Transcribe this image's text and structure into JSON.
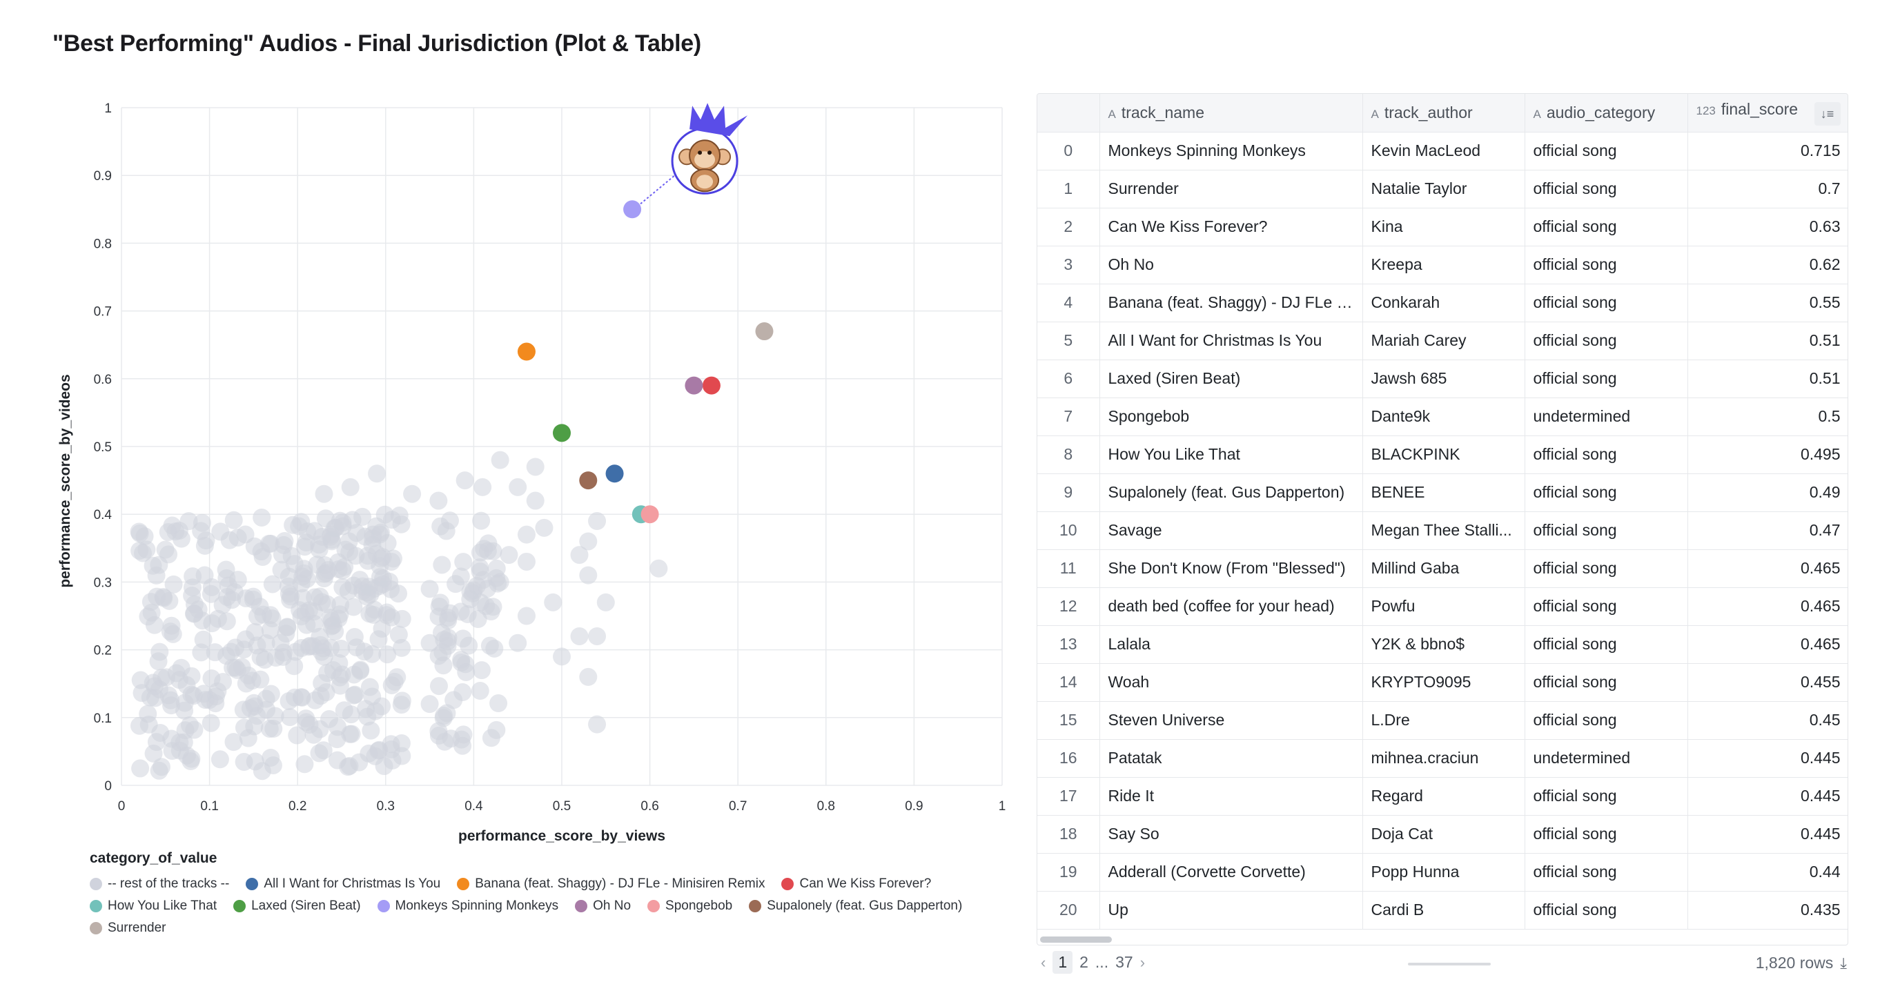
{
  "page": {
    "title": "\"Best Performing\" Audios - Final Jurisdiction (Plot & Table)"
  },
  "chart_data": {
    "type": "scatter",
    "xlabel": "performance_score_by_views",
    "ylabel": "performance_score_by_videos",
    "xlim": [
      0,
      1
    ],
    "ylim": [
      0,
      1
    ],
    "x_ticks": [
      "0",
      "0.1",
      "0.2",
      "0.3",
      "0.4",
      "0.5",
      "0.6",
      "0.7",
      "0.8",
      "0.9",
      "1"
    ],
    "y_ticks": [
      "0",
      "0.1",
      "0.2",
      "0.3",
      "0.4",
      "0.5",
      "0.6",
      "0.7",
      "0.8",
      "0.9",
      "1"
    ],
    "grid": true,
    "legend_title": "category_of_value",
    "legend_position": "bottom-left",
    "annotation": "crowned-monkey-icon pointing to Monkeys Spinning Monkeys",
    "series": [
      {
        "name": "-- rest of the tracks --",
        "color": "#d0d3dd",
        "background": true,
        "clusters": [
          {
            "x": [
              0.02,
              0.32
            ],
            "y": [
              0.02,
              0.4
            ],
            "n": 380
          },
          {
            "x": [
              0.36,
              0.43
            ],
            "y": [
              0.05,
              0.4
            ],
            "n": 70
          }
        ],
        "points": [
          {
            "x": 0.43,
            "y": 0.48
          },
          {
            "x": 0.47,
            "y": 0.47
          },
          {
            "x": 0.45,
            "y": 0.44
          },
          {
            "x": 0.41,
            "y": 0.44
          },
          {
            "x": 0.39,
            "y": 0.45
          },
          {
            "x": 0.36,
            "y": 0.42
          },
          {
            "x": 0.47,
            "y": 0.42
          },
          {
            "x": 0.48,
            "y": 0.38
          },
          {
            "x": 0.46,
            "y": 0.37
          },
          {
            "x": 0.54,
            "y": 0.39
          },
          {
            "x": 0.53,
            "y": 0.36
          },
          {
            "x": 0.52,
            "y": 0.34
          },
          {
            "x": 0.46,
            "y": 0.33
          },
          {
            "x": 0.53,
            "y": 0.31
          },
          {
            "x": 0.61,
            "y": 0.32
          },
          {
            "x": 0.55,
            "y": 0.27
          },
          {
            "x": 0.49,
            "y": 0.27
          },
          {
            "x": 0.46,
            "y": 0.25
          },
          {
            "x": 0.52,
            "y": 0.22
          },
          {
            "x": 0.5,
            "y": 0.19
          },
          {
            "x": 0.54,
            "y": 0.22
          },
          {
            "x": 0.53,
            "y": 0.16
          },
          {
            "x": 0.54,
            "y": 0.09
          },
          {
            "x": 0.33,
            "y": 0.43
          },
          {
            "x": 0.29,
            "y": 0.46
          },
          {
            "x": 0.26,
            "y": 0.44
          },
          {
            "x": 0.23,
            "y": 0.43
          },
          {
            "x": 0.35,
            "y": 0.29
          },
          {
            "x": 0.35,
            "y": 0.21
          },
          {
            "x": 0.35,
            "y": 0.12
          },
          {
            "x": 0.45,
            "y": 0.21
          },
          {
            "x": 0.43,
            "y": 0.3
          },
          {
            "x": 0.44,
            "y": 0.34
          },
          {
            "x": 0.36,
            "y": 0.08
          },
          {
            "x": 0.42,
            "y": 0.07
          }
        ]
      },
      {
        "name": "All I Want for Christmas Is You",
        "color": "#3f6ea8",
        "points": [
          {
            "x": 0.56,
            "y": 0.46
          }
        ]
      },
      {
        "name": "Banana (feat. Shaggy) - DJ FLe - Minisiren Remix",
        "color": "#f28a1e",
        "points": [
          {
            "x": 0.46,
            "y": 0.64
          }
        ]
      },
      {
        "name": "Can We Kiss Forever?",
        "color": "#e1494f",
        "points": [
          {
            "x": 0.67,
            "y": 0.59
          }
        ]
      },
      {
        "name": "How You Like That",
        "color": "#72c1ba",
        "points": [
          {
            "x": 0.59,
            "y": 0.4
          }
        ]
      },
      {
        "name": "Laxed (Siren Beat)",
        "color": "#4e9e45",
        "points": [
          {
            "x": 0.5,
            "y": 0.52
          }
        ]
      },
      {
        "name": "Monkeys Spinning Monkeys",
        "color": "#a49cf6",
        "points": [
          {
            "x": 0.58,
            "y": 0.85
          }
        ]
      },
      {
        "name": "Oh No",
        "color": "#a87aa6",
        "points": [
          {
            "x": 0.65,
            "y": 0.59
          }
        ]
      },
      {
        "name": "Spongebob",
        "color": "#f39da1",
        "points": [
          {
            "x": 0.6,
            "y": 0.4
          }
        ]
      },
      {
        "name": "Supalonely (feat. Gus Dapperton)",
        "color": "#9b6b55",
        "points": [
          {
            "x": 0.53,
            "y": 0.45
          }
        ]
      },
      {
        "name": "Surrender",
        "color": "#bcb0aa",
        "points": [
          {
            "x": 0.73,
            "y": 0.67
          }
        ]
      }
    ]
  },
  "table": {
    "columns": [
      {
        "label": "",
        "type": ""
      },
      {
        "label": "track_name",
        "type": "A"
      },
      {
        "label": "track_author",
        "type": "A"
      },
      {
        "label": "audio_category",
        "type": "A"
      },
      {
        "label": "final_score",
        "type": "123",
        "sort_icon": "sort-descending-icon"
      }
    ],
    "rows": [
      [
        "0",
        "Monkeys Spinning Monkeys",
        "Kevin MacLeod",
        "official song",
        "0.715"
      ],
      [
        "1",
        "Surrender",
        "Natalie Taylor",
        "official song",
        "0.7"
      ],
      [
        "2",
        "Can We Kiss Forever?",
        "Kina",
        "official song",
        "0.63"
      ],
      [
        "3",
        "Oh No",
        "Kreepa",
        "official song",
        "0.62"
      ],
      [
        "4",
        "Banana (feat. Shaggy) - DJ FLe - Mi",
        "Conkarah",
        "official song",
        "0.55"
      ],
      [
        "5",
        "All I Want for Christmas Is You",
        "Mariah Carey",
        "official song",
        "0.51"
      ],
      [
        "6",
        "Laxed (Siren Beat)",
        "Jawsh 685",
        "official song",
        "0.51"
      ],
      [
        "7",
        "Spongebob",
        "Dante9k",
        "undetermined",
        "0.5"
      ],
      [
        "8",
        "How You Like That",
        "BLACKPINK",
        "official song",
        "0.495"
      ],
      [
        "9",
        "Supalonely (feat. Gus Dapperton)",
        "BENEE",
        "official song",
        "0.49"
      ],
      [
        "10",
        "Savage",
        "Megan Thee Stalli...",
        "official song",
        "0.47"
      ],
      [
        "11",
        "She Don't Know (From \"Blessed\")",
        "Millind Gaba",
        "official song",
        "0.465"
      ],
      [
        "12",
        "death bed (coffee for your head)",
        "Powfu",
        "official song",
        "0.465"
      ],
      [
        "13",
        "Lalala",
        "Y2K & bbno$",
        "official song",
        "0.465"
      ],
      [
        "14",
        "Woah",
        "KRYPTO9095",
        "official song",
        "0.455"
      ],
      [
        "15",
        "Steven Universe",
        "L.Dre",
        "official song",
        "0.45"
      ],
      [
        "16",
        "Patatak",
        "mihnea.craciun",
        "undetermined",
        "0.445"
      ],
      [
        "17",
        "Ride It",
        "Regard",
        "official song",
        "0.445"
      ],
      [
        "18",
        "Say So",
        "Doja Cat",
        "official song",
        "0.445"
      ],
      [
        "19",
        "Adderall (Corvette Corvette)",
        "Popp Hunna",
        "official song",
        "0.44"
      ],
      [
        "20",
        "Up",
        "Cardi B",
        "official song",
        "0.435"
      ]
    ]
  },
  "pagination": {
    "prev_icon": "chevron-left-icon",
    "pages": [
      "1",
      "2",
      "...",
      "37"
    ],
    "next_icon": "chevron-right-icon",
    "row_count": "1,820 rows",
    "download_icon": "download-icon"
  }
}
